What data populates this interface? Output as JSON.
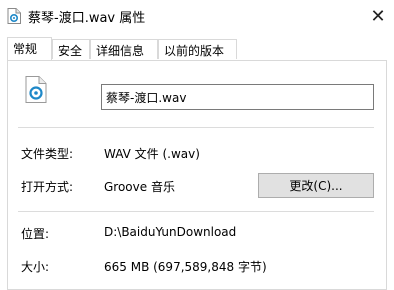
{
  "window": {
    "title": "蔡琴-渡口.wav 属性",
    "close_glyph": "✕"
  },
  "tabs": [
    {
      "label": "常规",
      "active": true
    },
    {
      "label": "安全",
      "active": false
    },
    {
      "label": "详细信息",
      "active": false
    },
    {
      "label": "以前的版本",
      "active": false
    }
  ],
  "general": {
    "file_name": "蔡琴-渡口.wav",
    "file_type_label": "文件类型:",
    "file_type_value": "WAV 文件 (.wav)",
    "opens_with_label": "打开方式:",
    "opens_with_value": "Groove 音乐",
    "change_button": "更改(C)...",
    "location_label": "位置:",
    "location_value": "D:\\BaiduYunDownload",
    "size_label": "大小:",
    "size_value": "665 MB (697,589,848 字节)"
  },
  "icons": {
    "title": "audio-file-icon",
    "file": "audio-file-icon",
    "app": "groove-music-icon"
  },
  "colors": {
    "accent": "#1e88c8",
    "button_bg": "#e1e1e1"
  }
}
